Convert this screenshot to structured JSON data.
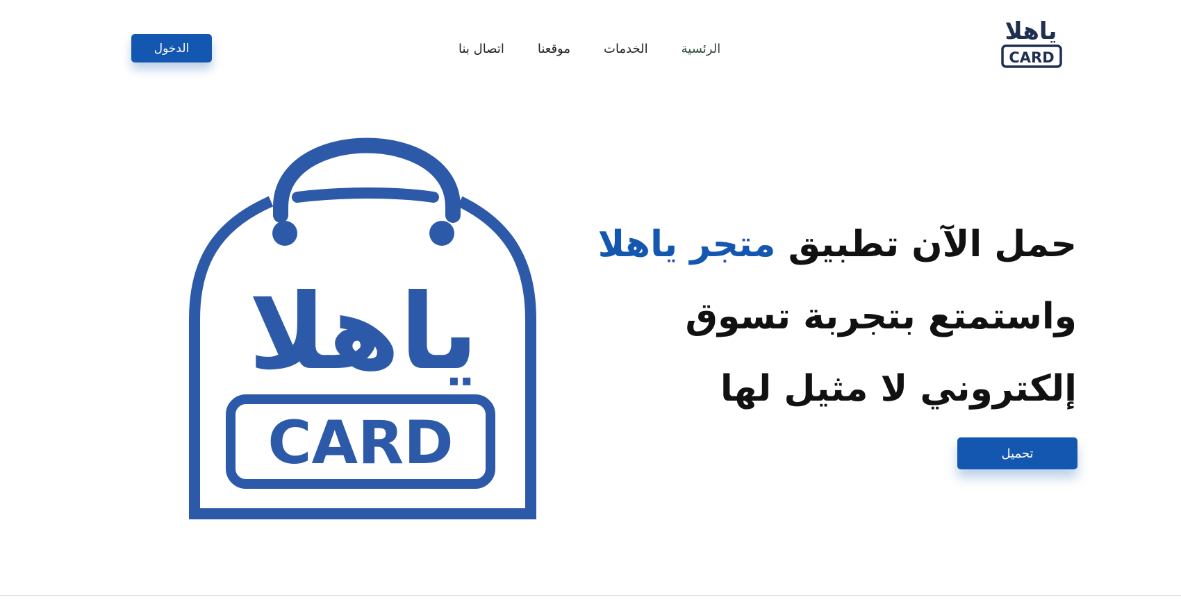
{
  "brand": {
    "logo_arabic": "ياهلا",
    "logo_latin": "CARD",
    "color": "#1457b0",
    "illustration_color": "#2d5aa8"
  },
  "nav": {
    "items": [
      {
        "label": "الرئسية"
      },
      {
        "label": "الخدمات"
      },
      {
        "label": "موقعنا"
      },
      {
        "label": "اتصال بنا"
      }
    ],
    "login_label": "الدخول"
  },
  "hero": {
    "line1_start": "حمل الآن تطبيق ",
    "line1_accent": "متجر ياهلا",
    "line2": "واستمتع بتجربة تسوق",
    "line3": "إلكتروني لا مثيل لها",
    "download_label": "تحميل"
  }
}
